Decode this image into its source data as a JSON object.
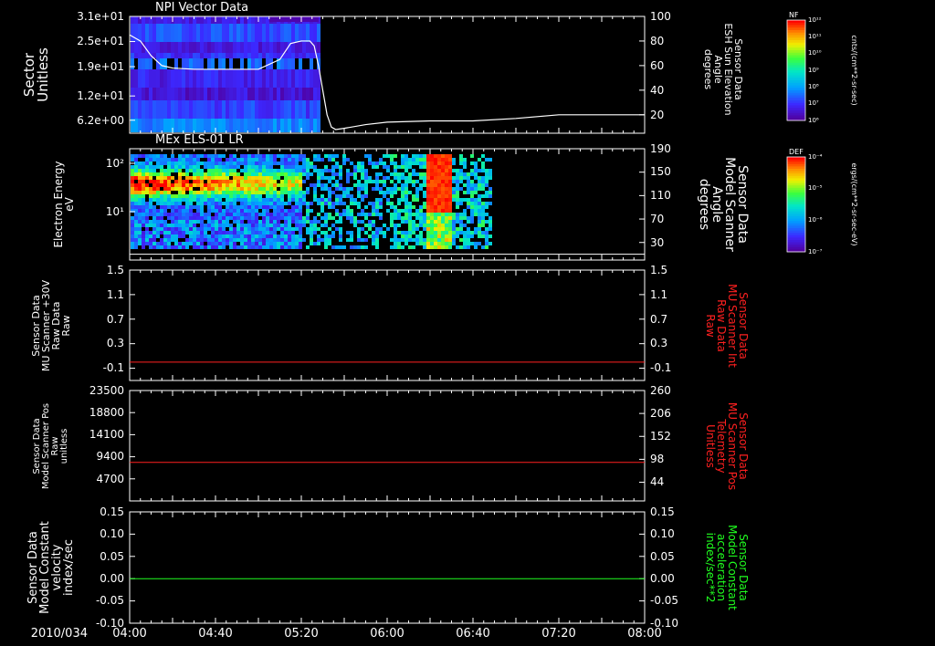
{
  "figure": {
    "date_label": "2010/034",
    "time_ticks": [
      "04:00",
      "04:40",
      "05:20",
      "06:00",
      "06:40",
      "07:20",
      "08:00"
    ],
    "x_range_minutes": [
      0,
      240
    ]
  },
  "colors": {
    "red": "#ff2020",
    "green": "#20ff20",
    "white": "#ffffff"
  },
  "chart_data": [
    {
      "type": "heatmap",
      "title": "NPI Vector Data",
      "ylabel_lines": [
        "Sector",
        "Unitless"
      ],
      "yticks": [
        "3.1e+01",
        "2.5e+01",
        "1.9e+01",
        "1.2e+01",
        "6.2e+00"
      ],
      "ytick_values": [
        31,
        25,
        19,
        12,
        6.2
      ],
      "ylim": [
        3.1,
        31
      ],
      "right_axis": {
        "label_lines": [
          "Sensor Data",
          "ESH Sun Elevation",
          "Angle",
          "degrees"
        ],
        "ticks": [
          "100",
          "80",
          "60",
          "40",
          "20"
        ],
        "ylim": [
          5,
          100
        ]
      },
      "data_extent_minutes": [
        0,
        88
      ],
      "overlay_line": {
        "color": "#ffffff",
        "x_minutes": [
          0,
          5,
          10,
          15,
          20,
          30,
          40,
          50,
          60,
          70,
          75,
          80,
          84,
          86,
          88,
          90,
          92,
          94,
          96,
          100,
          110,
          120,
          140,
          160,
          180,
          200,
          220,
          240
        ],
        "y_degrees": [
          85,
          80,
          68,
          60,
          58,
          57,
          57,
          57,
          57,
          65,
          78,
          80,
          80,
          76,
          60,
          40,
          20,
          10,
          8,
          9,
          12,
          14,
          15,
          15,
          17,
          20,
          20,
          20
        ]
      },
      "colorbar": {
        "label": "NF",
        "unit_label": "cnts/(cm**2-sr-sec)",
        "ticks": [
          "10¹²",
          "10¹¹",
          "10¹⁰",
          "10⁹",
          "10⁸",
          "10⁷",
          "10⁶"
        ]
      }
    },
    {
      "type": "heatmap",
      "title": "MEx ELS-01 LR",
      "ylabel_lines": [
        "Electron Energy",
        "eV"
      ],
      "yticks": [
        "10²",
        "10¹"
      ],
      "ytick_values": [
        100,
        10
      ],
      "ylim": [
        1,
        200
      ],
      "ylog": true,
      "right_axis": {
        "label_lines": [
          "Sensor Data",
          "Model Scanner",
          "Angle",
          "degrees"
        ],
        "ticks": [
          "190",
          "150",
          "110",
          "70",
          "30"
        ],
        "ylim": [
          0,
          190
        ]
      },
      "data_extent_minutes": [
        0,
        168
      ],
      "overlay_line": {
        "color": "#ffffff",
        "y_degrees": 10
      },
      "colorbar": {
        "label": "DEF",
        "unit_label": "ergs/(cm**2-sr-sec-eV)",
        "ticks": [
          "10⁻⁴",
          "10⁻⁵",
          "10⁻⁶",
          "10⁻⁷"
        ]
      }
    },
    {
      "type": "line",
      "ylabel_lines": [
        "Sensor Data",
        "MU Scanner +30V",
        "Raw Data",
        "Raw"
      ],
      "yticks": [
        "1.5",
        "1.1",
        "0.7",
        "0.3",
        "-0.1"
      ],
      "ylim": [
        -0.3,
        1.5
      ],
      "right_axis": {
        "label_lines": [
          "Sensor Data",
          "MU Scanner Int",
          "Raw Data",
          "Raw"
        ],
        "ticks": [
          "1.5",
          "1.1",
          "0.7",
          "0.3",
          "-0.1"
        ],
        "ylim": [
          -0.3,
          1.5
        ],
        "label_color": "#ff2020"
      },
      "series": [
        {
          "color": "#ff2020",
          "x_minutes": [
            0,
            240
          ],
          "y": [
            0.0,
            0.0
          ]
        }
      ]
    },
    {
      "type": "line",
      "ylabel_lines": [
        "Sensor Data",
        "Model Scanner Pos",
        "Raw",
        "unitless"
      ],
      "yticks": [
        "23500",
        "18800",
        "14100",
        "9400",
        "4700"
      ],
      "ylim": [
        0,
        23500
      ],
      "right_axis": {
        "label_lines": [
          "Sensor Data",
          "MU Scanner Pos",
          "Telemetry",
          "Unitless"
        ],
        "ticks": [
          "260",
          "206",
          "152",
          "98",
          "44"
        ],
        "ylim": [
          0,
          260
        ],
        "label_color": "#ff2020"
      },
      "series": [
        {
          "color": "#ff2020",
          "x_minutes": [
            0,
            240
          ],
          "y": [
            8200,
            8200
          ]
        }
      ]
    },
    {
      "type": "line",
      "ylabel_lines": [
        "Sensor Data",
        "Model Constant",
        "velocity",
        "index/sec"
      ],
      "yticks": [
        "0.15",
        "0.10",
        "0.05",
        "0.00",
        "-0.05",
        "-0.10"
      ],
      "ylim": [
        -0.1,
        0.15
      ],
      "right_axis": {
        "label_lines": [
          "Sensor Data",
          "Model Constant",
          "acceleration",
          "index/sec**2"
        ],
        "ticks": [
          "0.15",
          "0.10",
          "0.05",
          "0.00",
          "-0.05",
          "-0.10"
        ],
        "ylim": [
          -0.1,
          0.15
        ],
        "label_color": "#20ff20"
      },
      "series": [
        {
          "color": "#20ff20",
          "x_minutes": [
            0,
            240
          ],
          "y": [
            0.0,
            0.0
          ]
        }
      ]
    }
  ]
}
